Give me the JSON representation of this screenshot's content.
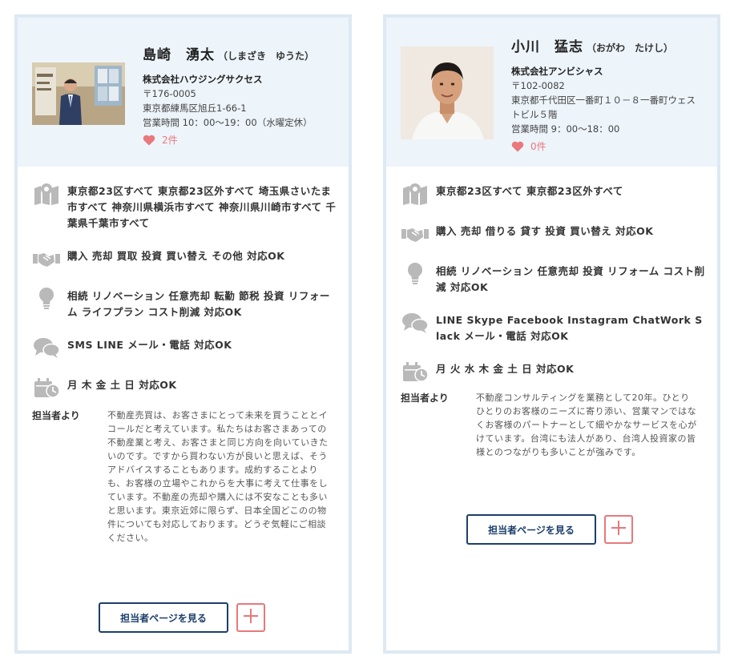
{
  "colors": {
    "accent": "#e8787c",
    "navy": "#1c3f6a",
    "card_border": "#dde9f3",
    "card_head": "#edf4fa",
    "icon_gray": "#b9b9b9"
  },
  "agents": [
    {
      "name": "島崎　湧太",
      "kana": "（しまざき　ゆうた）",
      "company": "株式会社ハウジングサクセス",
      "postal": "〒176-0005",
      "address": "東京都練馬区旭丘1-66-1",
      "hours": "営業時間 10：00〜19：00（水曜定休）",
      "likes": "2件",
      "features": [
        {
          "icon": "map-icon",
          "text": "東京都23区すべて 東京都23区外すべて 埼玉県さいたま市すべて 神奈川県横浜市すべて 神奈川県川崎市すべて 千葉県千葉市すべて"
        },
        {
          "icon": "handshake-icon",
          "text": "購入 売却 買取 投資 買い替え その他 対応OK"
        },
        {
          "icon": "lightbulb-icon",
          "text": "相続 リノベーション 任意売却 転勤 節税 投資 リフォーム ライフプラン コスト削減 対応OK"
        },
        {
          "icon": "chat-icon",
          "text": "SMS LINE メール・電話 対応OK"
        },
        {
          "icon": "calendar-icon",
          "text": "月 木 金 土 日 対応OK"
        }
      ],
      "message_label": "担当者より",
      "message": "不動産売買は、お客さまにとって未来を買うこととイコールだと考えています。私たちはお客さまあっての不動産業と考え、お客さまと同じ方向を向いていきたいのです。ですから買わない方が良いと思えば、そうアドバイスすることもあります。成約することよりも、お客様の立場やこれからを大事に考えて仕事をしています。不動産の売却や購入には不安なことも多いと思います。東京近郊に限らず、日本全国どこのの物件についても対応しております。どうぞ気軽にご相談ください。",
      "button_label": "担当者ページを見る"
    },
    {
      "name": "小川　猛志",
      "kana": "（おがわ　たけし）",
      "company": "株式会社アンビシャス",
      "postal": "〒102-0082",
      "address": "東京都千代田区一番町１０－８一番町ウェストビル５階",
      "hours": "営業時間 9：00〜18：00",
      "likes": "0件",
      "features": [
        {
          "icon": "map-icon",
          "text": "東京都23区すべて 東京都23区外すべて"
        },
        {
          "icon": "handshake-icon",
          "text": "購入 売却 借りる 貸す 投資 買い替え 対応OK"
        },
        {
          "icon": "lightbulb-icon",
          "text": "相続 リノベーション 任意売却 投資 リフォーム コスト削減 対応OK"
        },
        {
          "icon": "chat-icon",
          "text": "LINE Skype Facebook Instagram ChatWork Slack メール・電話 対応OK"
        },
        {
          "icon": "calendar-icon",
          "text": "月 火 水 木 金 土 日 対応OK"
        }
      ],
      "message_label": "担当者より",
      "message": "不動産コンサルティングを業務として20年。ひとりひとりのお客様のニーズに寄り添い、営業マンではなくお客様のパートナーとして細やかなサービスを心がけています。台湾にも法人があり、台湾人投資家の皆様とのつながりも多いことが強みです。",
      "button_label": "担当者ページを見る"
    }
  ]
}
